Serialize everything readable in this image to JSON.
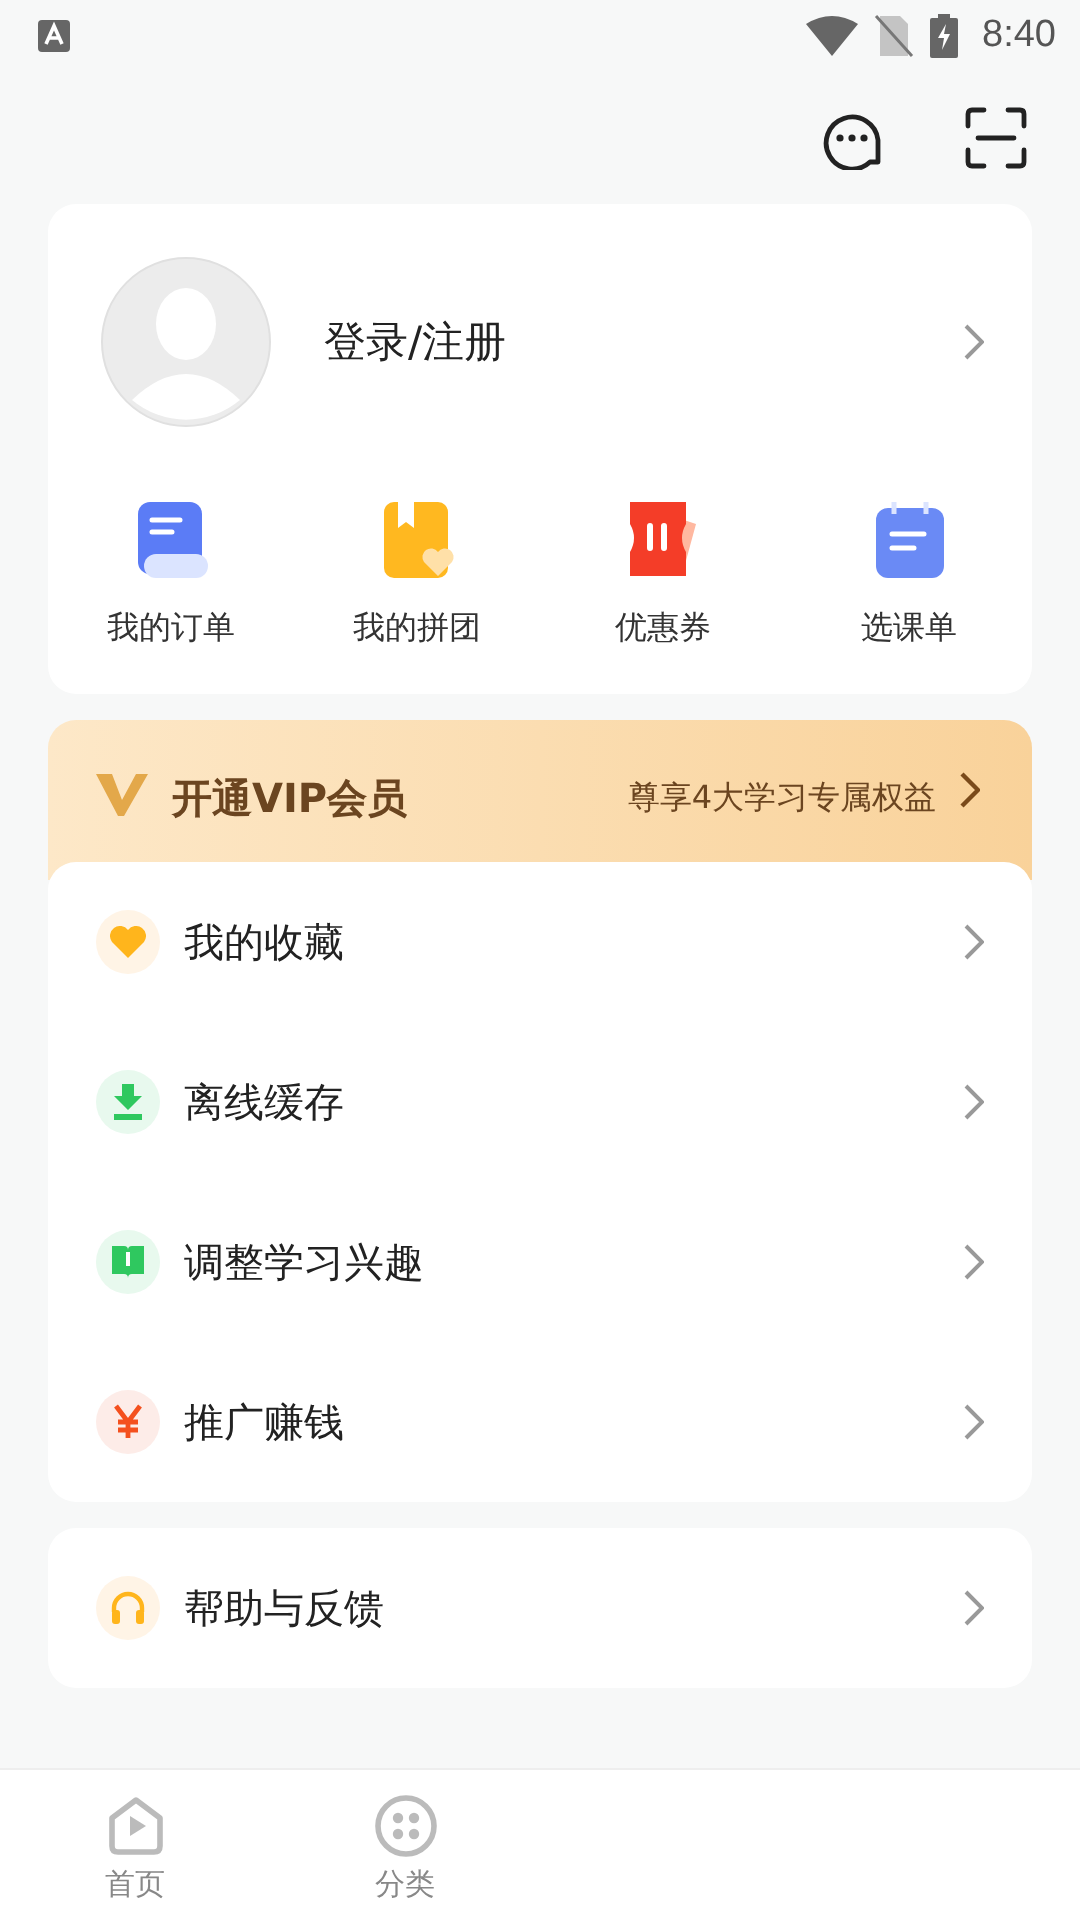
{
  "status_bar": {
    "time": "8:40"
  },
  "profile": {
    "login_label": "登录/注册"
  },
  "quick_actions": [
    {
      "kind": "order",
      "label": "我的订单"
    },
    {
      "kind": "group",
      "label": "我的拼团"
    },
    {
      "kind": "coupon",
      "label": "优惠券"
    },
    {
      "kind": "course",
      "label": "选课单"
    }
  ],
  "vip_banner": {
    "title": "开通VIP会员",
    "subtitle": "尊享4大学习专属权益"
  },
  "menu": [
    {
      "kind": "heart",
      "label": "我的收藏"
    },
    {
      "kind": "download",
      "label": "离线缓存"
    },
    {
      "kind": "book",
      "label": "调整学习兴趣"
    },
    {
      "kind": "yen",
      "label": "推广赚钱"
    }
  ],
  "menu_2": [
    {
      "kind": "headset",
      "label": "帮助与反馈"
    }
  ],
  "tab_bar": [
    {
      "kind": "home",
      "label": "首页",
      "selected": false
    },
    {
      "kind": "category",
      "label": "分类",
      "selected": false
    }
  ]
}
